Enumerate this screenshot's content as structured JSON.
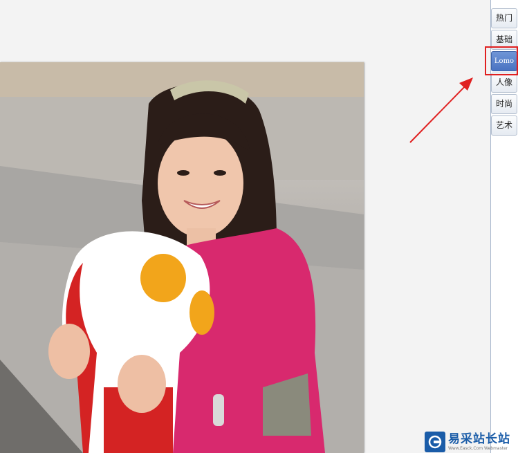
{
  "panel": {
    "tabs": [
      {
        "label": "热门"
      },
      {
        "label": "基础"
      },
      {
        "label": "Lomo",
        "selected": true
      },
      {
        "label": "人像"
      },
      {
        "label": "时尚"
      },
      {
        "label": "艺术"
      }
    ]
  },
  "photo": {
    "description_icon": "photo-of-girl-with-plush-toy"
  },
  "annotation": {
    "highlight_color": "#e02020",
    "arrow_color": "#e02020"
  },
  "watermark": {
    "title": "易采站长站",
    "subtitle": "Www.Easck.Com  Webmaster"
  }
}
